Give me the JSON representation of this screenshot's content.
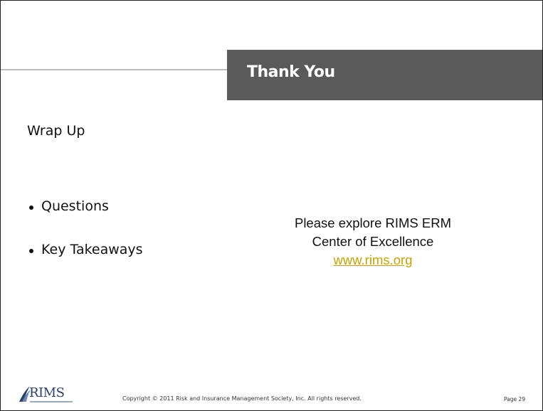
{
  "slide": {
    "title": "Thank You",
    "section_heading": "Wrap Up",
    "bullets": [
      {
        "label": "Questions"
      },
      {
        "label": "Key Takeaways"
      }
    ],
    "explore": {
      "line1": "Please explore RIMS ERM",
      "line2": "Center of Excellence",
      "link": "www.rims.org"
    }
  },
  "footer": {
    "logo_text": "RIMS",
    "logo_icon": "rims-swoosh-logo",
    "copyright": "Copyright © 2011 Risk and Insurance Management Society, Inc. All rights reserved.",
    "page_label": "Page 29"
  },
  "colors": {
    "title_bar": "#5a5a5a",
    "link": "#c8a200",
    "logo": "#2a3f6b"
  }
}
